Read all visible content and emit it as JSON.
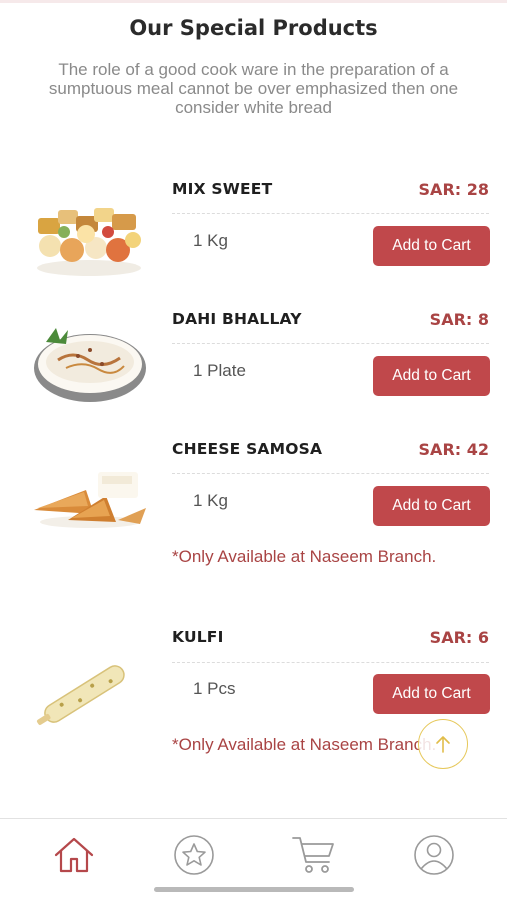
{
  "header": {
    "title": "Our Special Products",
    "subtitle": "The role of a good cook ware in the preparation of a sumptuous meal cannot be over emphasized then one consider white bread"
  },
  "products": [
    {
      "name": "MIX SWEET",
      "price": "SAR: 28",
      "unit": "1 Kg",
      "button": "Add to Cart",
      "image_icon": "mixed-sweets-image"
    },
    {
      "name": "DAHI BHALLAY",
      "price": "SAR: 8",
      "unit": "1 Plate",
      "button": "Add to Cart",
      "image_icon": "dahi-bhallay-bowl-image"
    },
    {
      "name": "CHEESE SAMOSA",
      "price": "SAR: 42",
      "unit": "1 Kg",
      "button": "Add to Cart",
      "note": "*Only Available at Naseem Branch.",
      "image_icon": "samosa-image"
    },
    {
      "name": "KULFI",
      "price": "SAR: 6",
      "unit": "1 Pcs",
      "button": "Add to Cart",
      "note": "*Only Available at Naseem Branch.",
      "image_icon": "kulfi-stick-image"
    }
  ],
  "scroll_top": {
    "icon": "arrow-up-icon"
  },
  "bottom_nav": [
    {
      "id": "home",
      "icon": "home-icon",
      "active": true
    },
    {
      "id": "favorites",
      "icon": "star-icon",
      "active": false
    },
    {
      "id": "cart",
      "icon": "cart-icon",
      "active": false
    },
    {
      "id": "profile",
      "icon": "user-icon",
      "active": false
    }
  ],
  "colors": {
    "accent": "#c0484b",
    "price": "#a94444",
    "active_nav": "#b5484b",
    "inactive_nav": "#9a9a9a"
  }
}
